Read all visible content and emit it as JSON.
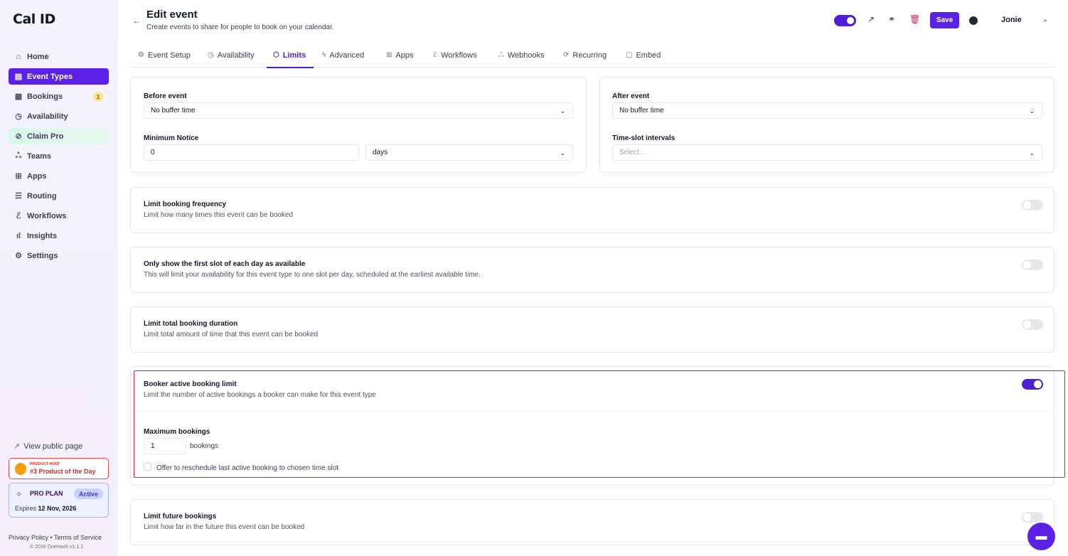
{
  "sidebar": {
    "logo": "Cal ID",
    "items": [
      {
        "label": "Home",
        "icon": "home-icon"
      },
      {
        "label": "Event Types",
        "icon": "event-types-icon"
      },
      {
        "label": "Bookings",
        "icon": "calendar-icon",
        "badge": "1"
      },
      {
        "label": "Availability",
        "icon": "clock-icon"
      },
      {
        "label": "Claim Pro",
        "icon": "claim-icon"
      },
      {
        "label": "Teams",
        "icon": "users-icon"
      },
      {
        "label": "Apps",
        "icon": "apps-icon"
      },
      {
        "label": "Routing",
        "icon": "routing-icon"
      },
      {
        "label": "Workflows",
        "icon": "workflows-icon"
      },
      {
        "label": "Insights",
        "icon": "bar-chart-icon"
      },
      {
        "label": "Settings",
        "icon": "gear-icon"
      }
    ],
    "view_public_page": "View public page",
    "product_hunt": {
      "small": "PRODUCT HUNT",
      "big": "#3 Product of the Day"
    },
    "pro_plan": {
      "title": "PRO PLAN",
      "status": "Active",
      "expires_label": "Expires",
      "expires_date": "12 Nov, 2026"
    },
    "footer_links": "Privacy Policy • Terms of Service",
    "footer_copy": "© 2026 OneHash v1.1.1"
  },
  "header": {
    "title": "Edit event",
    "subtitle": "Create events to share for people to book on your calendar.",
    "save_label": "Save",
    "user_name": "Jonie"
  },
  "tabs": [
    {
      "label": "Event Setup",
      "icon": "gear-icon"
    },
    {
      "label": "Availability",
      "icon": "clock-icon"
    },
    {
      "label": "Limits",
      "icon": "shield-icon",
      "active": true
    },
    {
      "label": "Advanced",
      "icon": "bolt-icon"
    },
    {
      "label": "Apps",
      "icon": "apps-icon"
    },
    {
      "label": "Workflows",
      "icon": "workflows-icon"
    },
    {
      "label": "Webhooks",
      "icon": "webhook-icon"
    },
    {
      "label": "Recurring",
      "icon": "repeat-icon"
    },
    {
      "label": "Embed",
      "icon": "clipboard-icon"
    }
  ],
  "buffers": {
    "before_label": "Before event",
    "before_value": "No buffer time",
    "min_notice_label": "Minimum Notice",
    "min_notice_value": "0",
    "min_notice_unit": "days",
    "after_label": "After event",
    "after_value": "No buffer time",
    "interval_label": "Time-slot intervals",
    "interval_placeholder": "Select..."
  },
  "settings": {
    "frequency": {
      "title": "Limit booking frequency",
      "desc": "Limit how many times this event can be booked",
      "enabled": false
    },
    "first_slot": {
      "title": "Only show the first slot of each day as available",
      "desc": "This will limit your availability for this event type to one slot per day, scheduled at the earliest available time.",
      "enabled": false
    },
    "duration": {
      "title": "Limit total booking duration",
      "desc": "Limit total amount of time that this event can be booked",
      "enabled": false
    },
    "booker_limit": {
      "title": "Booker active booking limit",
      "desc": "Limit the number of active bookings a booker can make for this event type",
      "enabled": true,
      "max_label": "Maximum bookings",
      "max_value": "1",
      "max_unit": "bookings",
      "reschedule_label": "Offer to reschedule last active booking to chosen time slot"
    },
    "future": {
      "title": "Limit future bookings",
      "desc": "Limit how far in the future this event can be booked",
      "enabled": false
    }
  },
  "colors": {
    "accent": "#5b21e6",
    "highlight_border": "#e11d48"
  }
}
